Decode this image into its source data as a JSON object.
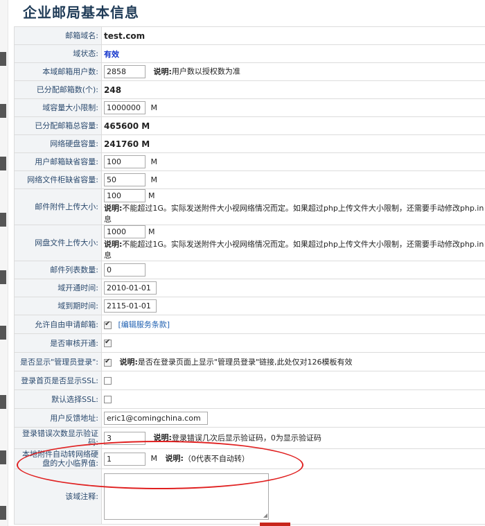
{
  "page": {
    "title": "企业邮局基本信息"
  },
  "fields": {
    "domain_name": {
      "label": "邮箱域名:",
      "value": "test.com"
    },
    "domain_status": {
      "label": "域状态:",
      "value": "有效"
    },
    "user_count": {
      "label": "本域邮箱用户数:",
      "value": "2858",
      "note_label": "说明:",
      "note_text": "用户数以授权数为准"
    },
    "allocated_boxes": {
      "label": "已分配邮箱数(个):",
      "value": "248"
    },
    "domain_capacity": {
      "label": "域容量大小限制:",
      "value": "1000000",
      "unit": "M"
    },
    "allocated_total": {
      "label": "已分配邮箱总容量:",
      "value": "465600 M"
    },
    "netdisk_capacity": {
      "label": "网络硬盘容量:",
      "value": "241760 M"
    },
    "default_mailbox": {
      "label": "用户邮箱缺省容量:",
      "value": "100",
      "unit": "M"
    },
    "default_filecab": {
      "label": "网络文件柜缺省容量:",
      "value": "50",
      "unit": "M"
    },
    "attach_size": {
      "label": "邮件附件上传大小:",
      "value": "100",
      "unit": "M",
      "note_label": "说明:",
      "note_text": "不能超过1G。实际发送附件大小视网络情况而定。如果超过php上传文件大小限制，还需要手动修改php.in",
      "note_tail": "息"
    },
    "disk_upload_size": {
      "label": "网盘文件上传大小:",
      "value": "1000",
      "unit": "M",
      "note_label": "说明:",
      "note_text": "不能超过1G。实际发送附件大小视网络情况而定。如果超过php上传文件大小限制，还需要手动修改php.in",
      "note_tail": "息"
    },
    "list_count": {
      "label": "邮件列表数量:",
      "value": "0"
    },
    "open_date": {
      "label": "域开通时间:",
      "value": "2010-01-01"
    },
    "expire_date": {
      "label": "域到期时间:",
      "value": "2115-01-01"
    },
    "free_apply": {
      "label": "允许自由申请邮箱:",
      "link": "[编辑服务条款]"
    },
    "need_review": {
      "label": "是否审核开通:"
    },
    "show_admin_login": {
      "label": "是否显示\"管理员登录\":",
      "note_label": "说明:",
      "note_text": "是否在登录页面上显示\"管理员登录\"链接,此处仅对126模板有效"
    },
    "login_ssl": {
      "label": "登录首页是否显示SSL:"
    },
    "default_ssl": {
      "label": "默认选择SSL:"
    },
    "feedback": {
      "label": "用户反馈地址:",
      "value": "eric1@comingchina.com"
    },
    "captcha_errors": {
      "label1": "登录错误次数显示验证",
      "label2": "码:",
      "value": "3",
      "note_label": "说明:",
      "note_text": "登录错误几次后显示验证码，0为显示验证码"
    },
    "auto_transfer": {
      "label1": "本地附件自动转网络硬",
      "label2": "盘的大小临界值:",
      "value": "1",
      "unit": "M",
      "note_label": "说明:",
      "note_text": "（0代表不自动转）"
    },
    "domain_comment": {
      "label": "该域注释:",
      "value": ""
    }
  }
}
